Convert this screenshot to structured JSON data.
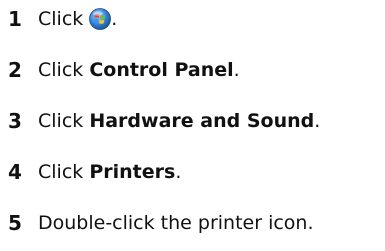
{
  "steps": [
    {
      "number": "1",
      "prefix": "Click",
      "icon": "windows-start-orb-icon",
      "suffix": "."
    },
    {
      "number": "2",
      "prefix": "Click",
      "target": "Control Panel",
      "suffix": "."
    },
    {
      "number": "3",
      "prefix": "Click",
      "target": "Hardware and Sound",
      "suffix": "."
    },
    {
      "number": "4",
      "prefix": "Click",
      "target": "Printers",
      "suffix": "."
    },
    {
      "number": "5",
      "text": "Double-click the printer icon."
    }
  ],
  "colors": {
    "text": "#111111",
    "orb_blue": "#2f7fd6",
    "orb_red": "#e8452c",
    "orb_green": "#6fbf3a",
    "orb_yellow": "#f5c430"
  }
}
